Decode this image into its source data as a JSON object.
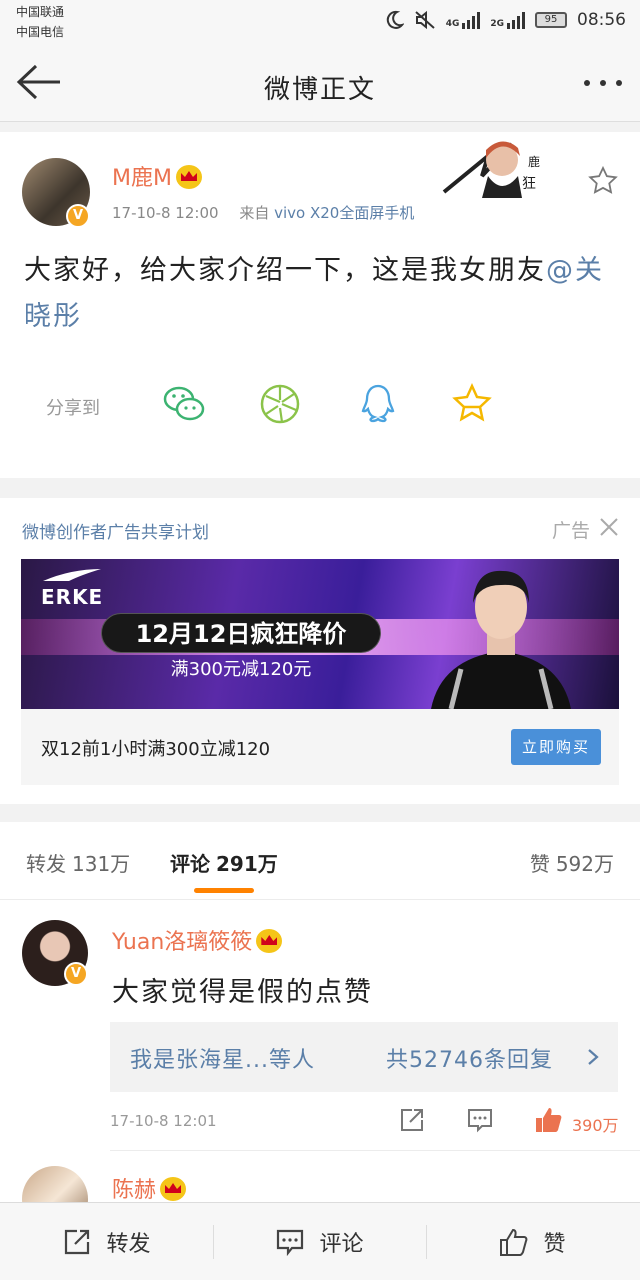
{
  "status_bar": {
    "carrier1": "中国联通",
    "carrier2": "中国电信",
    "net1": "4G",
    "net2": "2G",
    "battery": "95",
    "time": "08:56"
  },
  "navbar": {
    "title": "微博正文"
  },
  "post": {
    "username": "M鹿M",
    "timestamp": "17-10-8 12:00",
    "source_prefix": "来自",
    "device": "vivo X20全面屏手机",
    "text": "大家好，给大家介绍一下，这是我女朋友",
    "mention": "@关晓彤",
    "share_label": "分享到"
  },
  "ad": {
    "title": "微博创作者广告共享计划",
    "label": "广告",
    "brand": "ERKE",
    "headline": "12月12日疯狂降价",
    "subline": "满300元减120元",
    "description": "双12前1小时满300立减120",
    "button": "立即购买"
  },
  "tabs": {
    "repost_label": "转发",
    "repost_count": "131万",
    "comment_label": "评论",
    "comment_count": "291万",
    "like_label": "赞",
    "like_count": "592万"
  },
  "comments": [
    {
      "username": "Yuan洛璃筱筱",
      "text": "大家觉得是假的点赞",
      "replies_who": "我是张海星...等人",
      "replies_count": "共52746条回复",
      "time": "17-10-8 12:01",
      "likes": "390万"
    },
    {
      "username": "陈赫"
    }
  ],
  "toolbar": {
    "repost": "转发",
    "comment": "评论",
    "like": "赞"
  },
  "colors": {
    "accent": "#ff8200",
    "username": "#eb7350",
    "link": "#5b7fa8",
    "button": "#4a90d9"
  }
}
